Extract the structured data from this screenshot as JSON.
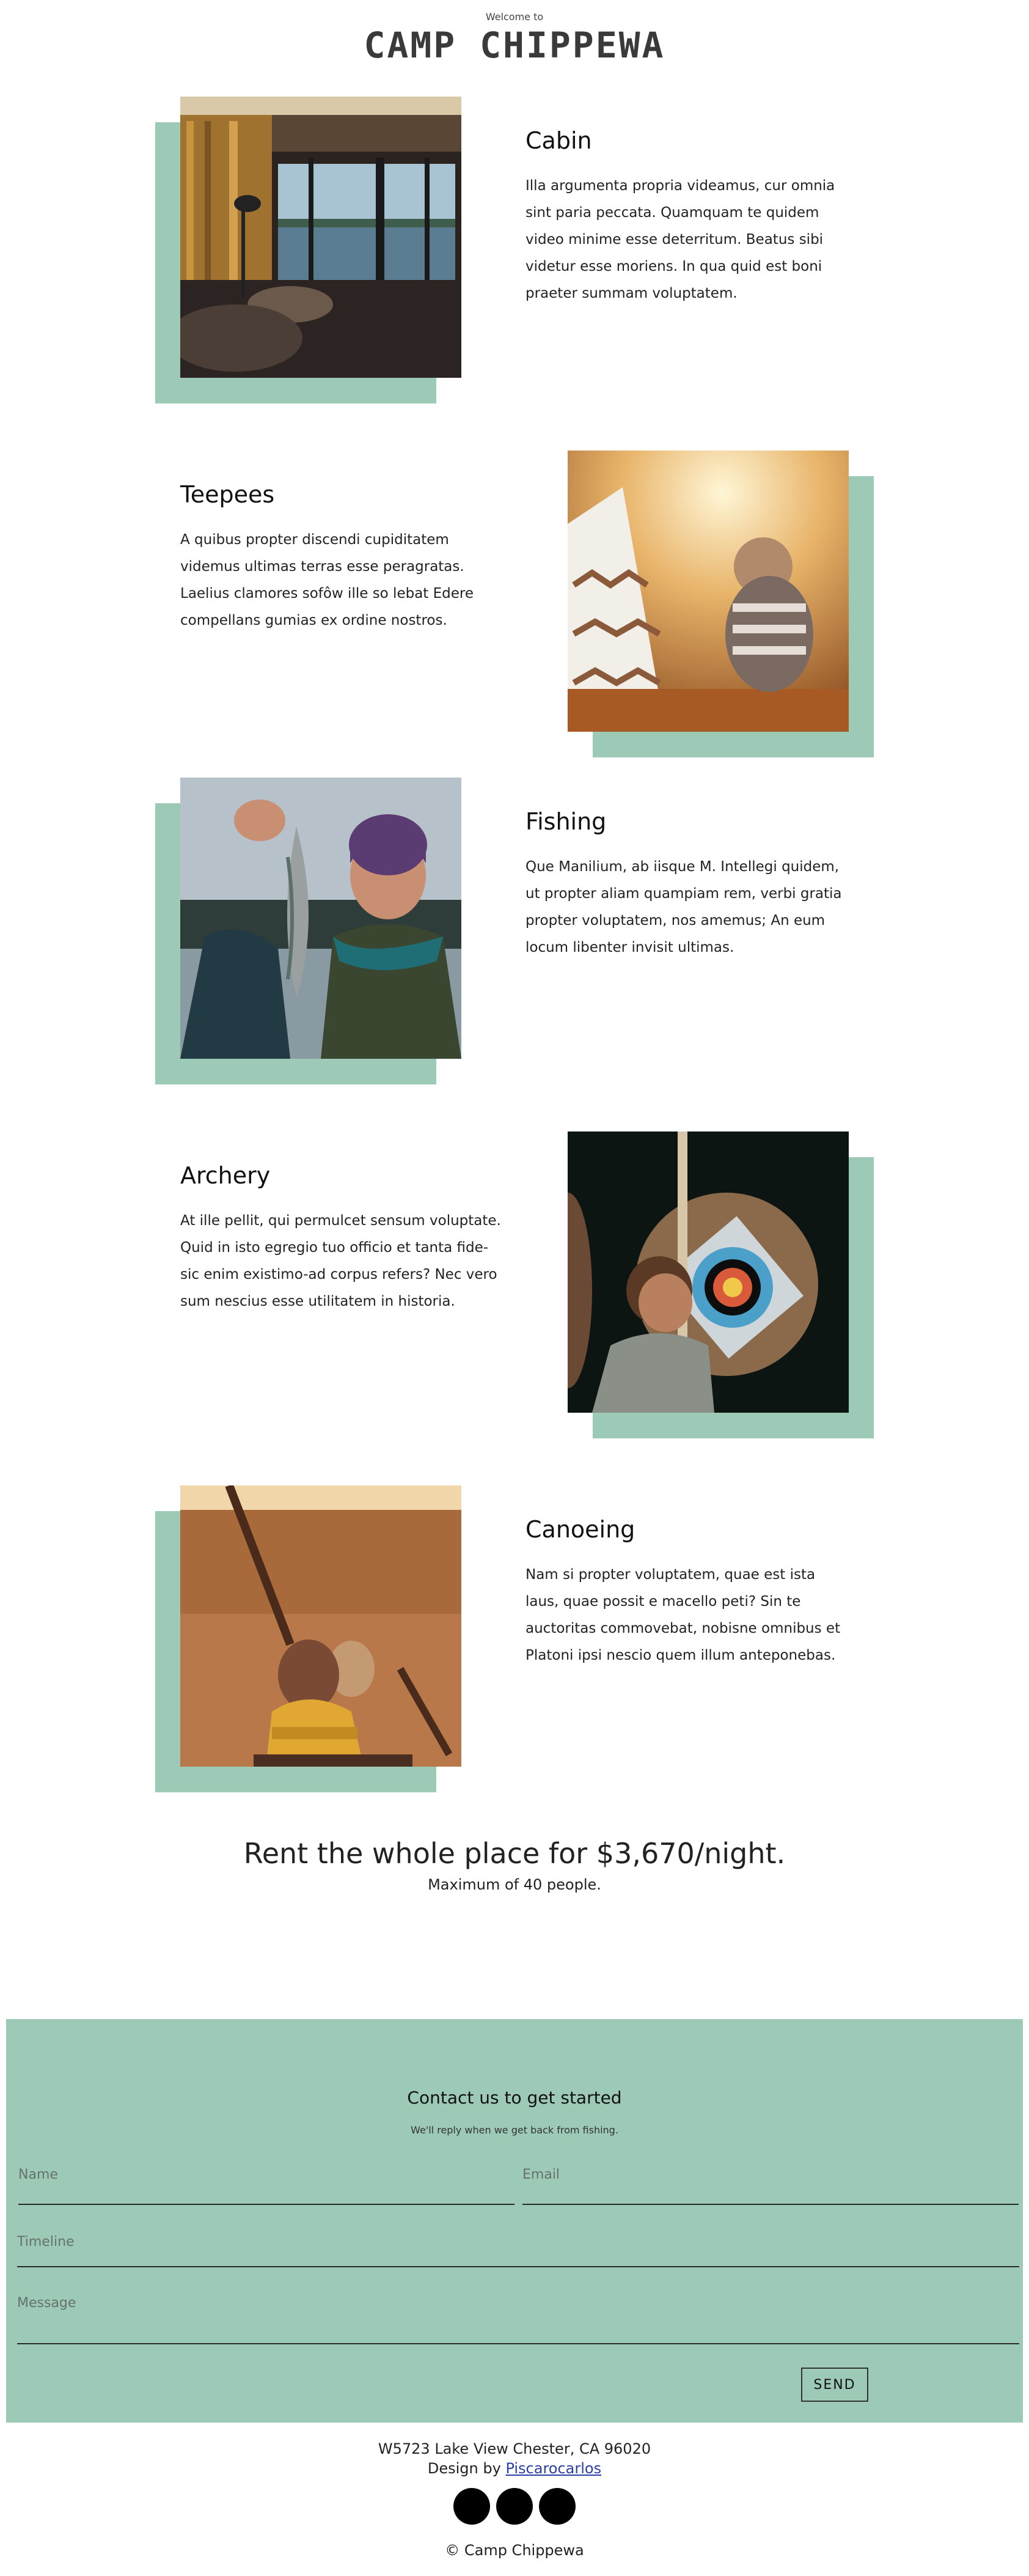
{
  "header": {
    "welcome": "Welcome to",
    "logo": "CAMP CHIPPEWA"
  },
  "activities": [
    {
      "title": "Cabin",
      "body": "Illa argumenta propria videamus, cur omnia sint paria peccata. Quamquam te quidem video minime esse deterritum. Beatus sibi videtur esse moriens. In qua quid est boni praeter summam voluptatem.",
      "photo_icon": "cabin-interior-photo"
    },
    {
      "title": "Teepees",
      "body": "A quibus propter discendi cupiditatem videmus ultimas terras esse peragratas. Laelius clamores sofôw ille so lebat Edere compellans gumias ex ordine nostros.",
      "photo_icon": "teepee-child-photo"
    },
    {
      "title": "Fishing",
      "body": "Que Manilium, ab iisque M. Intellegi quidem, ut propter aliam quampiam rem, verbi gratia propter voluptatem, nos amemus; An eum locum libenter invisit ultimas.",
      "photo_icon": "fisherman-photo"
    },
    {
      "title": "Archery",
      "body": "At ille pellit, qui permulcet sensum voluptate. Quid in isto egregio tuo officio et tanta fide-sic enim existimo-ad corpus refers? Nec vero sum nescius esse utilitatem in historia.",
      "photo_icon": "archery-target-photo"
    },
    {
      "title": "Canoeing",
      "body": "Nam si propter voluptatem, quae est ista laus, quae possit e macello peti? Sin te auctoritas commovebat, nobisne omnibus et Platoni ipsi nescio quem illum anteponebas.",
      "photo_icon": "canoe-paddlers-photo"
    }
  ],
  "rent": {
    "title": "Rent the whole place for $3,670/night.",
    "subtitle": "Maximum of 40 people."
  },
  "contact": {
    "title": "Contact us to get started",
    "subtitle": "We'll reply when we get back from fishing.",
    "name_label": "Name",
    "email_label": "Email",
    "timeline_label": "Timeline",
    "message_label": "Message",
    "send_label": "SEND"
  },
  "footer": {
    "address": "W5723 Lake View Chester, CA 96020",
    "design_prefix": "Design by ",
    "design_link": "Piscarocarlos",
    "copyright": "© Camp Chippewa",
    "social_icons": [
      "social-icon",
      "social-icon",
      "social-icon"
    ]
  },
  "colors": {
    "accent": "#9ccab7",
    "text": "#222222",
    "link": "#2b3fa8"
  }
}
